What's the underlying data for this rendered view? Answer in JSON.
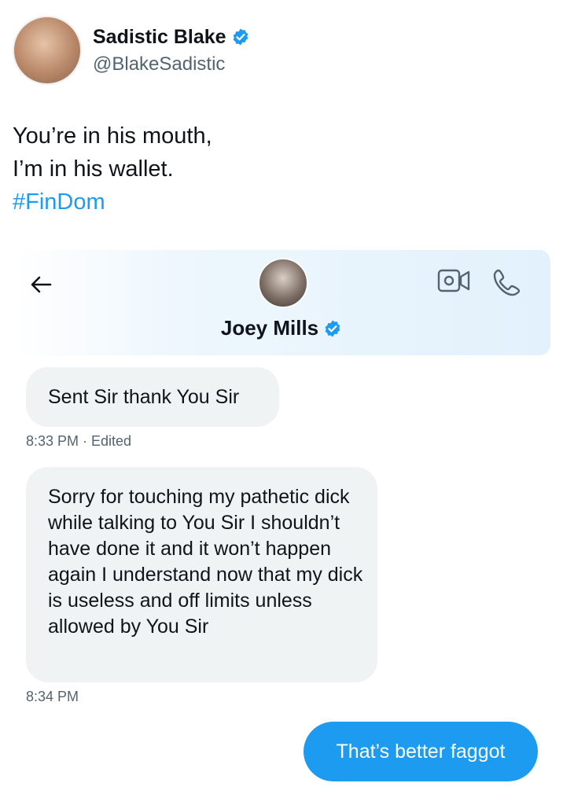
{
  "post": {
    "author_name": "Sadistic Blake",
    "author_handle": "@BlakeSadistic",
    "text_line1": "You’re in his mouth,",
    "text_line2": "I’m in his wallet.",
    "hashtag": "#FinDom"
  },
  "dm": {
    "contact_name": "Joey Mills",
    "icons": {
      "back": "back-arrow-icon",
      "video": "video-call-icon",
      "phone": "phone-call-icon",
      "verified": "verified-badge-icon"
    },
    "messages": [
      {
        "direction": "incoming",
        "text": "Sent Sir thank You Sir",
        "timestamp": "8:33 PM · Edited"
      },
      {
        "direction": "incoming",
        "text": "Sorry for touching my pathetic dick while talking to You Sir I shouldn’t have done it and it won’t happen again I understand now that my dick is useless and off limits unless allowed by You Sir",
        "timestamp": "8:34 PM"
      },
      {
        "direction": "outgoing",
        "text": "That’s better faggot"
      }
    ]
  },
  "colors": {
    "accent": "#1d9bf0",
    "bubble_incoming": "#eff3f4",
    "secondary_text": "#536471",
    "primary_text": "#0f1419"
  }
}
